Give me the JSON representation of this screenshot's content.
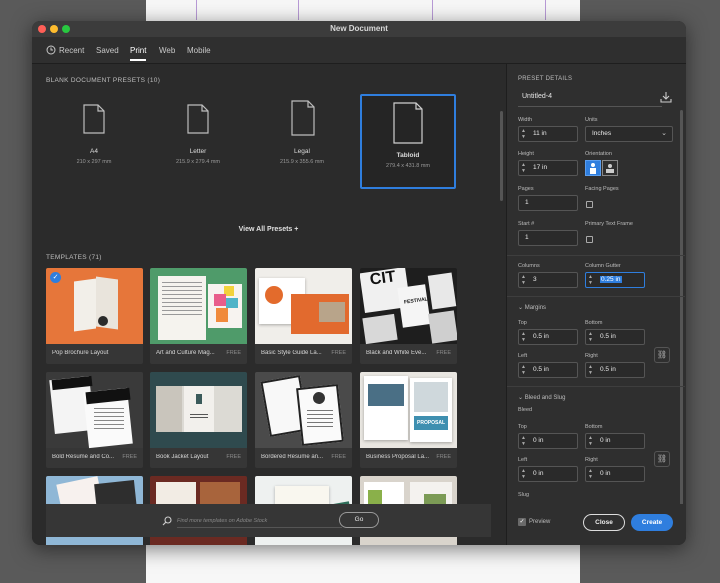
{
  "window": {
    "title": "New Document"
  },
  "tabs": [
    {
      "label": "Recent"
    },
    {
      "label": "Saved"
    },
    {
      "label": "Print"
    },
    {
      "label": "Web"
    },
    {
      "label": "Mobile"
    }
  ],
  "blank_presets": {
    "heading": "BLANK DOCUMENT PRESETS",
    "count": "(10)",
    "items": [
      {
        "name": "A4",
        "size": "210 x 297 mm"
      },
      {
        "name": "Letter",
        "size": "215.9 x 279.4 mm"
      },
      {
        "name": "Legal",
        "size": "215.9 x 355.6 mm"
      },
      {
        "name": "Tabloid",
        "size": "279.4 x 431.8 mm"
      }
    ],
    "view_all": "View All Presets +"
  },
  "templates": {
    "heading": "TEMPLATES",
    "count": "(71)",
    "items": [
      {
        "name": "Pop Brochure Layout",
        "free": ""
      },
      {
        "name": "Art and Culture Mag...",
        "free": "FREE"
      },
      {
        "name": "Basic Style Guide La...",
        "free": "FREE"
      },
      {
        "name": "Black and White Eve...",
        "free": "FREE"
      },
      {
        "name": "Bold Resume and Co...",
        "free": "FREE"
      },
      {
        "name": "Book Jacket Layout",
        "free": "FREE"
      },
      {
        "name": "Bordered Resume an...",
        "free": "FREE"
      },
      {
        "name": "Business Proposal La...",
        "free": "FREE"
      }
    ],
    "thumb_text": {
      "cit": "CIT",
      "festival": "FESTIVAL",
      "proposal": "PROPOSAL"
    }
  },
  "search": {
    "placeholder": "Find more templates on Adobe Stock",
    "go": "Go"
  },
  "details": {
    "heading": "PRESET DETAILS",
    "doc_name": "Untitled-4",
    "width_label": "Width",
    "width": "11 in",
    "units_label": "Units",
    "units": "Inches",
    "height_label": "Height",
    "height": "17 in",
    "orientation_label": "Orientation",
    "pages_label": "Pages",
    "pages": "1",
    "facing_label": "Facing Pages",
    "start_label": "Start #",
    "start": "1",
    "ptf_label": "Primary Text Frame",
    "columns_label": "Columns",
    "columns": "3",
    "gutter_label": "Column Gutter",
    "gutter": "0.25 in",
    "margins_label": "Margins",
    "top_label": "Top",
    "bottom_label": "Bottom",
    "left_label": "Left",
    "right_label": "Right",
    "m_top": "0.5 in",
    "m_bottom": "0.5 in",
    "m_left": "0.5 in",
    "m_right": "0.5 in",
    "bleed_slug_label": "Bleed and Slug",
    "bleed_label": "Bleed",
    "b_top": "0 in",
    "b_bottom": "0 in",
    "b_left": "0 in",
    "b_right": "0 in",
    "slug_label": "Slug",
    "preview_label": "Preview",
    "close": "Close",
    "create": "Create"
  },
  "colors": {
    "accent": "#2f7ede",
    "window": "#2b2b2b",
    "panel": "#2f2f2f"
  }
}
